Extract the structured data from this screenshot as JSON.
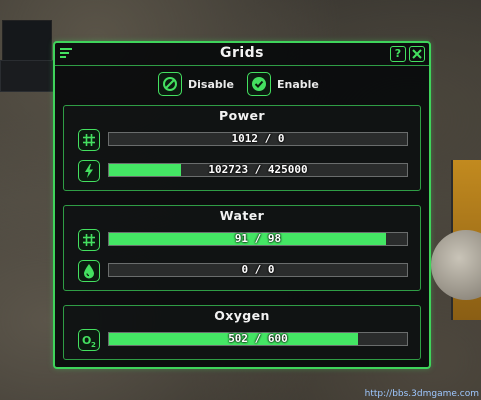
{
  "window": {
    "title": "Grids"
  },
  "toggles": {
    "disable_label": "Disable",
    "enable_label": "Enable"
  },
  "power": {
    "title": "Power",
    "rows": [
      {
        "icon": "grid-icon",
        "text": "1012 / 0",
        "fill": 0.0
      },
      {
        "icon": "lightning-icon",
        "text": "102723 / 425000",
        "fill": 0.242
      }
    ]
  },
  "water": {
    "title": "Water",
    "rows": [
      {
        "icon": "grid-icon",
        "text": "91 / 98",
        "fill": 0.929
      },
      {
        "icon": "water-drop-icon",
        "text": "0 / 0",
        "fill": 0.0
      }
    ]
  },
  "oxygen": {
    "title": "Oxygen",
    "rows": [
      {
        "icon": "o2-icon",
        "text": "502 / 600",
        "fill": 0.837
      }
    ]
  },
  "watermark": "http://bbs.3dmgame.com",
  "colors": {
    "accent": "#44e060",
    "bar_fill": "#44e664",
    "bar_track": "#2a2c2c",
    "panel_bg": "#08090b"
  }
}
